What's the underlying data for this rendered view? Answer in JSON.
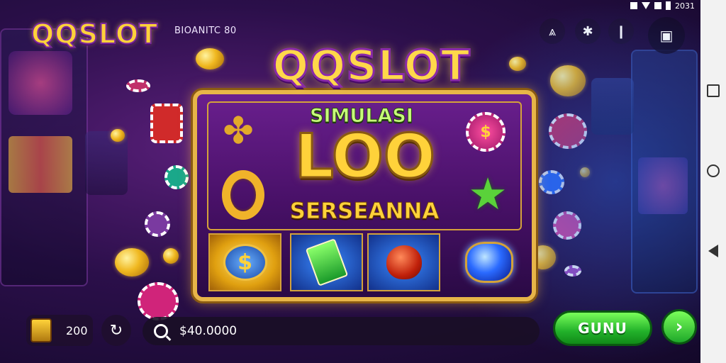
{
  "status_bar": {
    "time": "2031",
    "icons": [
      "sim-icon",
      "wifi-icon",
      "signal-icon",
      "battery-icon"
    ]
  },
  "header": {
    "logo": "QQSLOT",
    "label": "BIOANITC 80",
    "buttons": [
      "cheer-icon",
      "settings-icon",
      "hint-icon",
      "menu-icon"
    ]
  },
  "banner": {
    "logo": "QQSLOT",
    "title": "SIMULASI",
    "amount": "LOO",
    "subtitle": "SERSEANNA"
  },
  "bottom": {
    "balance": "200",
    "search_value": "$40.0000",
    "cta_label": "GUNU",
    "next_label": "›"
  },
  "colors": {
    "accent_gold": "#ffd23a",
    "purple": "#5a1f7a",
    "cta_green": "#22b12a"
  },
  "icons": {
    "refresh": "refresh-icon",
    "search": "search-icon",
    "treasure": "treasure-chest-icon"
  }
}
